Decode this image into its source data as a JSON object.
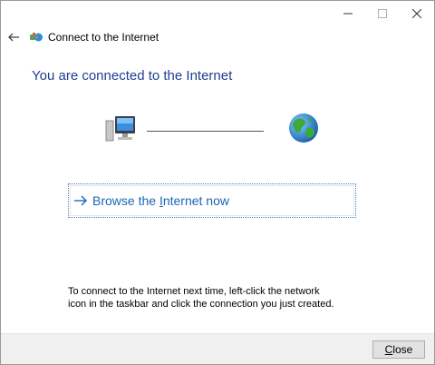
{
  "window": {
    "caption": {
      "minimize_icon": "minimize-icon",
      "maximize_icon": "maximize-icon",
      "close_icon": "close-icon"
    }
  },
  "header": {
    "back_icon": "back-arrow-icon",
    "wizard_icon": "network-wizard-icon",
    "title": "Connect to the Internet"
  },
  "main": {
    "heading": "You are connected to the Internet",
    "graphic": {
      "left_icon": "computer-icon",
      "right_icon": "globe-icon"
    },
    "command_link": {
      "icon": "arrow-right-icon",
      "label_start": "Browse the ",
      "label_accel": "I",
      "label_end": "nternet now"
    },
    "hint": "To connect to the Internet next time, left-click the network icon in the taskbar and click the connection you just created."
  },
  "footer": {
    "close_accel": "C",
    "close_rest": "lose"
  },
  "colors": {
    "heading": "#1f3e8f",
    "link": "#1b66b3",
    "footer_bg": "#f0f0f0"
  }
}
